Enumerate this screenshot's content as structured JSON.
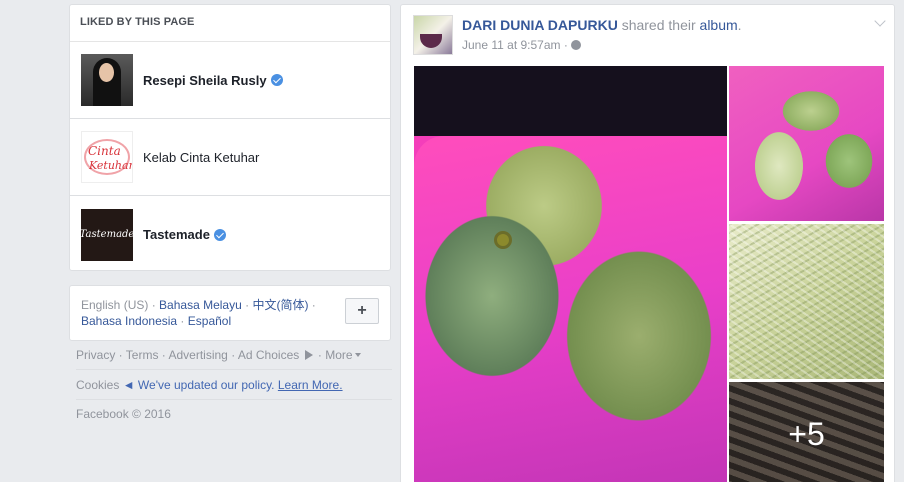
{
  "liked": {
    "header": "LIKED BY THIS PAGE",
    "items": [
      {
        "name": "Resepi Sheila Rusly",
        "verified": true
      },
      {
        "name": "Kelab Cinta Ketuhar",
        "verified": false,
        "logo_text_1": "Cinta",
        "logo_text_2": "Ketuhar"
      },
      {
        "name": "Tastemade",
        "verified": true,
        "logo_text": "Tastemade"
      }
    ]
  },
  "languages": {
    "current": "English (US)",
    "links": [
      "Bahasa Melayu",
      "中文(简体)",
      "Bahasa Indonesia",
      "Español"
    ],
    "add_label": "+"
  },
  "footer": {
    "links": [
      "Privacy",
      "Terms",
      "Advertising",
      "Ad Choices",
      "More"
    ],
    "cookies": "Cookies",
    "policy_update": "◄ We've updated our policy.",
    "learn_more": "Learn More.",
    "copyright": "Facebook © 2016"
  },
  "post": {
    "author": "DARI DUNIA DAPURKU",
    "action": " shared their ",
    "object": "album",
    "timestamp": "June 11 at 9:57am",
    "more_photos": "+5"
  }
}
